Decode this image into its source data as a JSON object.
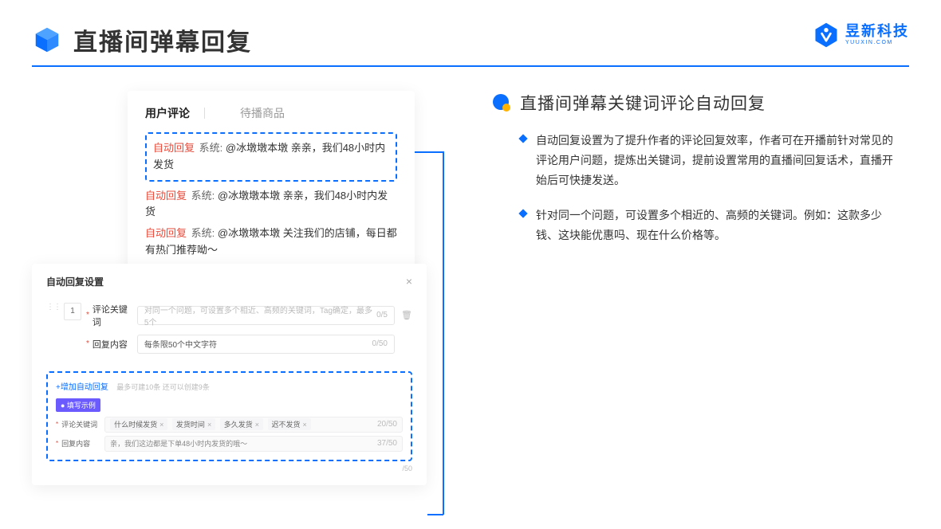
{
  "header": {
    "title": "直播间弹幕回复"
  },
  "logo": {
    "cn": "昱新科技",
    "en": "YUUXIN.COM"
  },
  "commentPanel": {
    "tab1": "用户评论",
    "tab2": "待播商品",
    "msg1_tag": "自动回复",
    "msg1_sys": "系统:",
    "msg1_body": "@冰墩墩本墩 亲亲，我们48小时内发货",
    "msg2_tag": "自动回复",
    "msg2_sys": "系统:",
    "msg2_body": "@冰墩墩本墩 亲亲，我们48小时内发货",
    "msg3_tag": "自动回复",
    "msg3_sys": "系统:",
    "msg3_body": "@冰墩墩本墩 关注我们的店铺，每日都有热门推荐呦～"
  },
  "settings": {
    "title": "自动回复设置",
    "idx": "1",
    "kwLabel": "评论关键词",
    "kwPlaceholder": "对同一个问题，可设置多个相近、高频的关键词，Tag确定，最多5个",
    "kwCount": "0/5",
    "contentLabel": "回复内容",
    "contentPlaceholder": "每条限50个中文字符",
    "contentCount": "0/50",
    "addLink": "+增加自动回复",
    "addNote": "最多可建10条 还可以创建9条",
    "badge": "● 填写示例",
    "exKwLabel": "评论关键词",
    "chip1": "什么时候发货",
    "chip2": "发货时间",
    "chip3": "多久发货",
    "chip4": "迟不发货",
    "exKwCount": "20/50",
    "exContentLabel": "回复内容",
    "exContentVal": "亲，我们这边都是下单48小时内发货的哦～",
    "exContentCount": "37/50",
    "outerCount": "/50"
  },
  "feature": {
    "title": "直播间弹幕关键词评论自动回复",
    "b1": "自动回复设置为了提升作者的评论回复效率，作者可在开播前针对常见的评论用户问题，提炼出关键词，提前设置常用的直播间回复话术，直播开始后可快捷发送。",
    "b2": "针对同一个问题，可设置多个相近的、高频的关键词。例如：这款多少钱、这块能优惠吗、现在什么价格等。"
  }
}
